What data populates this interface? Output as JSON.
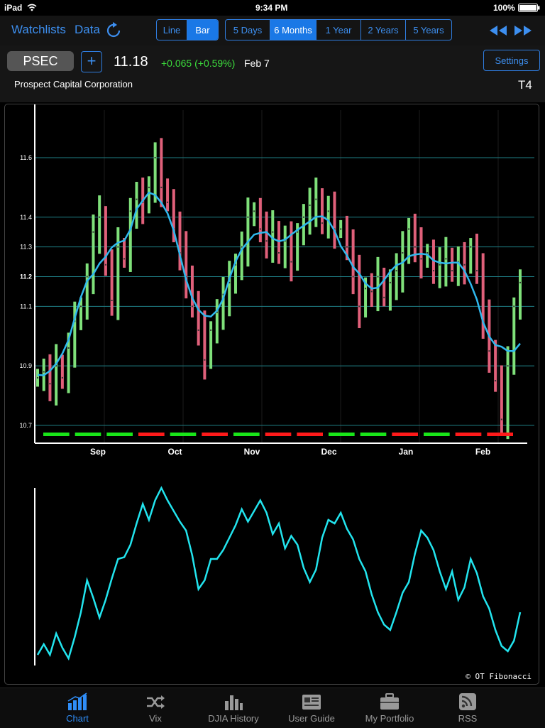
{
  "status_bar": {
    "device": "iPad",
    "time": "9:34 PM",
    "battery": "100%"
  },
  "toolbar": {
    "watchlists_label": "Watchlists",
    "data_label": "Data",
    "chart_styles": [
      {
        "label": "Line",
        "active": false
      },
      {
        "label": "Bar",
        "active": true
      }
    ],
    "ranges": [
      {
        "label": "5 Days",
        "active": false
      },
      {
        "label": "6 Months",
        "active": true
      },
      {
        "label": "1 Year",
        "active": false
      },
      {
        "label": "2 Years",
        "active": false
      },
      {
        "label": "5 Years",
        "active": false
      }
    ],
    "nav_icons": [
      "rewind-icon",
      "fast-forward-icon"
    ]
  },
  "quote": {
    "symbol": "PSEC",
    "add_label": "+",
    "price": "11.18",
    "change": "+0.065 (+0.59%)",
    "date": "Feb 7",
    "company": "Prospect Capital Corporation",
    "settings_label": "Settings",
    "chart_code": "T4"
  },
  "colors": {
    "accent": "#2f8df7",
    "up": "#7fe07a",
    "down": "#e0607a",
    "indicator": "#22e4ee",
    "ma": "#2fb8ee",
    "green_signal": "#19e619",
    "red_signal": "#ff1a1a"
  },
  "chart_data": {
    "type": "bar",
    "y_ticks": [
      "11.6",
      "11.4",
      "11.3",
      "11.2",
      "11.1",
      "10.9",
      "10.7"
    ],
    "ylim": [
      10.64,
      11.76
    ],
    "x_labels": [
      "Sep",
      "Oct",
      "Nov",
      "Dec",
      "Jan",
      "Feb"
    ],
    "closes": [
      10.86,
      10.88,
      10.84,
      10.9,
      10.86,
      10.96,
      11.05,
      11.1,
      11.2,
      11.35,
      11.4,
      11.24,
      11.12,
      11.3,
      11.26,
      11.42,
      11.46,
      11.45,
      11.5,
      11.6,
      11.5,
      11.45,
      11.36,
      11.28,
      11.2,
      11.1,
      11.02,
      10.92,
      11.02,
      11.08,
      11.14,
      11.18,
      11.24,
      11.3,
      11.4,
      11.42,
      11.36,
      11.32,
      11.35,
      11.28,
      11.32,
      11.25,
      11.35,
      11.4,
      11.44,
      11.46,
      11.38,
      11.42,
      11.36,
      11.36,
      11.3,
      11.2,
      11.1,
      11.16,
      11.15,
      11.2,
      11.13,
      11.18,
      11.22,
      11.28,
      11.36,
      11.3,
      11.26,
      11.28,
      11.22,
      11.24,
      11.26,
      11.22,
      11.25,
      11.24,
      11.3,
      11.22,
      11.05,
      10.95,
      10.85,
      10.72,
      10.9,
      11.1,
      11.18
    ],
    "signals": [
      "green",
      "green",
      "green",
      "red",
      "green",
      "red",
      "green",
      "red",
      "red",
      "green",
      "green",
      "red",
      "green",
      "red",
      "red"
    ],
    "indicator": [
      0.06,
      0.12,
      0.06,
      0.18,
      0.1,
      0.04,
      0.16,
      0.3,
      0.48,
      0.38,
      0.27,
      0.37,
      0.49,
      0.6,
      0.61,
      0.68,
      0.8,
      0.91,
      0.82,
      0.93,
      1.0,
      0.93,
      0.87,
      0.81,
      0.76,
      0.62,
      0.43,
      0.48,
      0.6,
      0.6,
      0.65,
      0.72,
      0.79,
      0.88,
      0.81,
      0.87,
      0.93,
      0.86,
      0.74,
      0.8,
      0.66,
      0.73,
      0.68,
      0.55,
      0.47,
      0.54,
      0.72,
      0.82,
      0.8,
      0.86,
      0.77,
      0.71,
      0.6,
      0.53,
      0.4,
      0.3,
      0.23,
      0.2,
      0.3,
      0.41,
      0.47,
      0.63,
      0.76,
      0.72,
      0.65,
      0.53,
      0.43,
      0.53,
      0.37,
      0.44,
      0.6,
      0.52,
      0.39,
      0.32,
      0.2,
      0.11,
      0.08,
      0.14,
      0.3
    ]
  },
  "copyright": "© OT Fibonacci",
  "tabs": [
    {
      "label": "Chart",
      "icon": "bar-chart-icon",
      "active": true
    },
    {
      "label": "Vix",
      "icon": "shuffle-icon",
      "active": false
    },
    {
      "label": "DJIA History",
      "icon": "column-chart-icon",
      "active": false
    },
    {
      "label": "User Guide",
      "icon": "newspaper-icon",
      "active": false
    },
    {
      "label": "My Portfolio",
      "icon": "briefcase-icon",
      "active": false
    },
    {
      "label": "RSS",
      "icon": "rss-icon",
      "active": false
    }
  ]
}
